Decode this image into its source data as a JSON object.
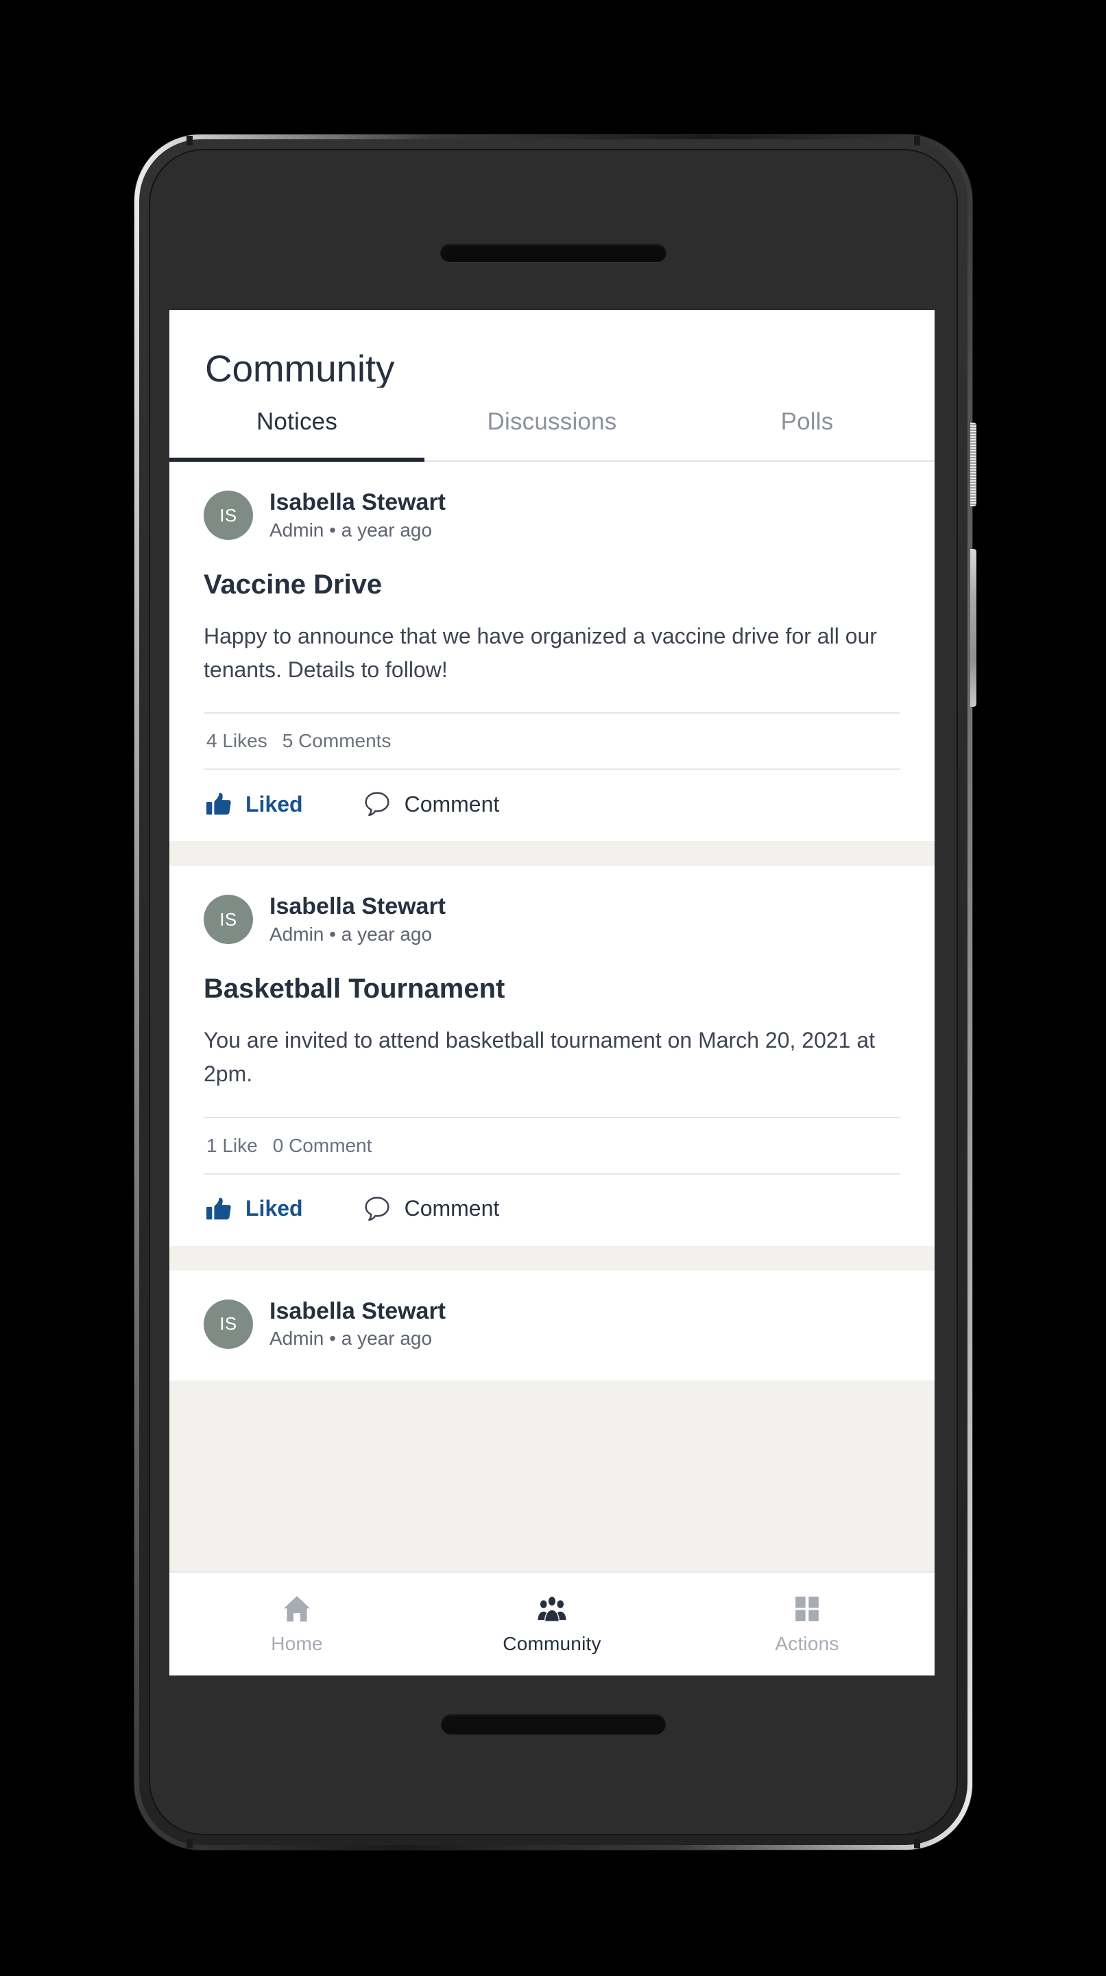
{
  "app": {
    "title": "Community"
  },
  "tabs": [
    {
      "label": "Notices",
      "active": true
    },
    {
      "label": "Discussions",
      "active": false
    },
    {
      "label": "Polls",
      "active": false
    }
  ],
  "posts": [
    {
      "avatar_initials": "IS",
      "author": "Isabella Stewart",
      "meta": "Admin • a year ago",
      "title": "Vaccine Drive",
      "body": "Happy to announce that we have organized a vaccine drive for all our tenants. Details to follow!",
      "likes": "4 Likes",
      "comments": "5 Comments",
      "like_action": "Liked",
      "comment_action": "Comment"
    },
    {
      "avatar_initials": "IS",
      "author": "Isabella Stewart",
      "meta": "Admin • a year ago",
      "title": "Basketball Tournament",
      "body": "You are invited to attend basketball tournament on March 20, 2021 at 2pm.",
      "likes": "1 Like",
      "comments": "0 Comment",
      "like_action": "Liked",
      "comment_action": "Comment"
    },
    {
      "avatar_initials": "IS",
      "author": "Isabella Stewart",
      "meta": "Admin • a year ago"
    }
  ],
  "bottom_nav": [
    {
      "label": "Home",
      "icon": "home-icon",
      "active": false
    },
    {
      "label": "Community",
      "icon": "people-group-icon",
      "active": true
    },
    {
      "label": "Actions",
      "icon": "grid-squares-icon",
      "active": false
    }
  ],
  "colors": {
    "accent_blue": "#17528f",
    "text_dark": "#27303f",
    "text_muted": "#8c919c",
    "avatar_bg": "#7f8c86",
    "feed_gap": "#f2f1ee"
  }
}
